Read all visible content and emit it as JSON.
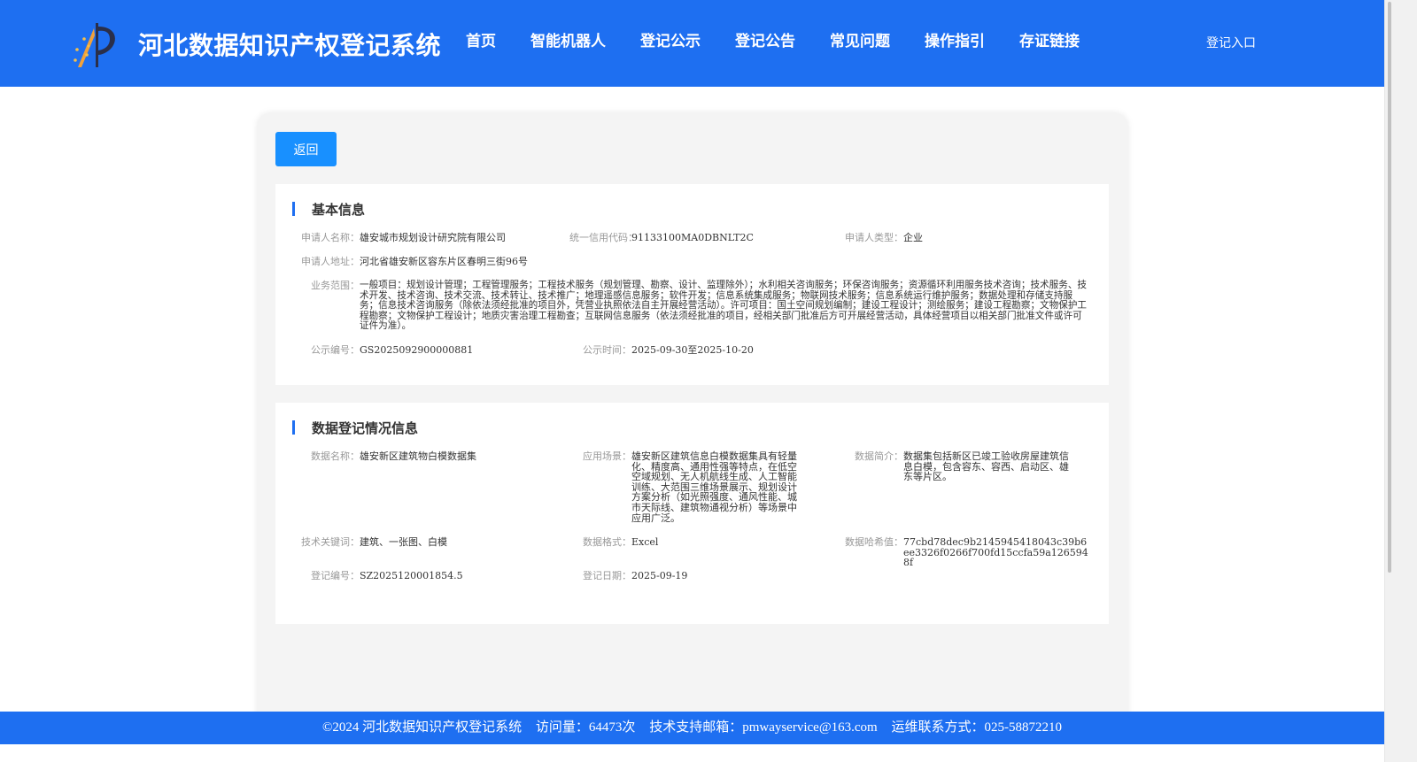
{
  "header": {
    "site_title": "河北数据知识产权登记系统",
    "nav": [
      "首页",
      "智能机器人",
      "登记公示",
      "登记公告",
      "常见问题",
      "操作指引",
      "存证链接"
    ],
    "login": "登记入口"
  },
  "back_button": "返回",
  "basic_info": {
    "title": "基本信息",
    "applicant_name_label": "申请人名称：",
    "applicant_name": "雄安城市规划设计研究院有限公司",
    "credit_code_label": "统一信用代码：",
    "credit_code": "91133100MA0DBNLT2C",
    "applicant_type_label": "申请人类型：",
    "applicant_type": "企业",
    "address_label": "申请人地址：",
    "address": "河北省雄安新区容东片区春明三街96号",
    "scope_label": "业务范围：",
    "scope": "一般项目：规划设计管理；工程管理服务；工程技术服务（规划管理、勘察、设计、监理除外）；水利相关咨询服务；环保咨询服务；资源循环利用服务技术咨询；技术服务、技术开发、技术咨询、技术交流、技术转让、技术推广；地理遥感信息服务；软件开发；信息系统集成服务；物联网技术服务；信息系统运行维护服务；数据处理和存储支持服务；信息技术咨询服务（除依法须经批准的项目外，凭营业执照依法自主开展经营活动）。许可项目：国土空间规划编制；建设工程设计；测绘服务；建设工程勘察；文物保护工程勘察；文物保护工程设计；地质灾害治理工程勘查；互联网信息服务（依法须经批准的项目，经相关部门批准后方可开展经营活动，具体经营项目以相关部门批准文件或许可证件为准）。",
    "notice_no_label": "公示编号：",
    "notice_no": "GS2025092900000881",
    "notice_time_label": "公示时间：",
    "notice_time": "2025-09-30至2025-10-20"
  },
  "data_info": {
    "title": "数据登记情况信息",
    "data_name_label": "数据名称：",
    "data_name": "雄安新区建筑物白模数据集",
    "scenario_label": "应用场景：",
    "scenario": "雄安新区建筑信息白模数据集具有轻量化、精度高、通用性强等特点，在低空空域规划、无人机航线生成、人工智能训练、大范围三维场景展示、规划设计方案分析（如光照强度、通风性能、城市天际线、建筑物通视分析）等场景中应用广泛。",
    "summary_label": "数据简介：",
    "summary": "数据集包括新区已竣工验收房屋建筑信息白模，包含容东、容西、启动区、雄东等片区。",
    "keywords_label": "技术关键词：",
    "keywords": "建筑、一张图、白模",
    "format_label": "数据格式：",
    "format": "Excel",
    "hash_label": "数据哈希值：",
    "hash": "77cbd78dec9b2145945418043c39b6ee3326f0266f700fd15ccfa59a1265948f",
    "reg_no_label": "登记编号：",
    "reg_no": "SZ2025120001854.5",
    "reg_date_label": "登记日期：",
    "reg_date": "2025-09-19"
  },
  "footer": {
    "copyright": "©2024 河北数据知识产权登记系统",
    "visits": "访问量：64473次",
    "email": "技术支持邮箱：pmwayservice@163.com",
    "phone": "运维联系方式：025-58872210"
  },
  "colors": {
    "brand": "#1e6ff1",
    "button": "#1890ff"
  }
}
